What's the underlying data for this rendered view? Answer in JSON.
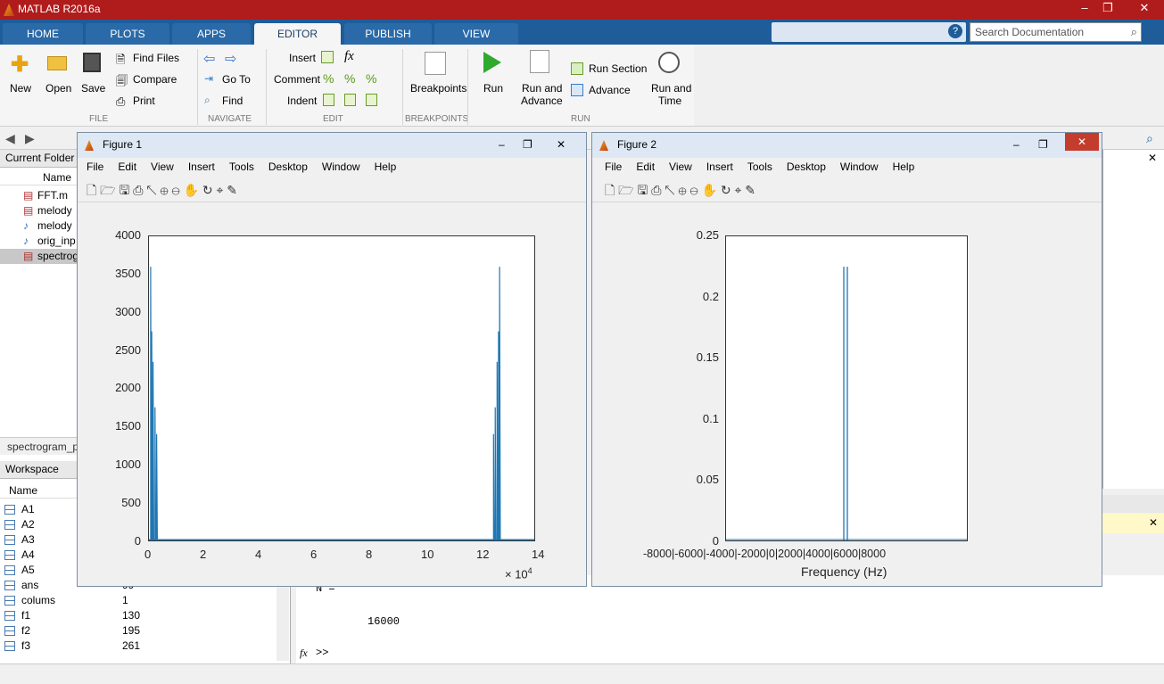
{
  "app": {
    "title": "MATLAB R2016a"
  },
  "ribbon": {
    "tabs": [
      "HOME",
      "PLOTS",
      "APPS",
      "EDITOR",
      "PUBLISH",
      "VIEW"
    ],
    "active_tab": "EDITOR",
    "search_placeholder": "Search Documentation",
    "file": {
      "new": "New",
      "open": "Open",
      "save": "Save",
      "find_files": "Find Files",
      "compare": "Compare",
      "print": "Print",
      "group": "FILE"
    },
    "navigate": {
      "go_to": "Go To",
      "find": "Find",
      "group": "NAVIGATE"
    },
    "edit": {
      "insert": "Insert",
      "comment": "Comment",
      "indent": "Indent",
      "fx": "fx",
      "group": "EDIT"
    },
    "breakpoints": {
      "label": "Breakpoints",
      "group": "BREAKPOINTS"
    },
    "run": {
      "run": "Run",
      "run_advance_1": "Run and",
      "run_advance_2": "Advance",
      "run_section": "Run Section",
      "advance": "Advance",
      "run_time_1": "Run and",
      "run_time_2": "Time",
      "group": "RUN"
    }
  },
  "current_folder": {
    "title": "Current Folder",
    "column": "Name",
    "files": [
      "FFT.m",
      "melody",
      "melody",
      "orig_inp",
      "spectrog"
    ],
    "selected_file": "spectrogram_p"
  },
  "workspace": {
    "title": "Workspace",
    "column": "Name",
    "vars": [
      {
        "name": "A1",
        "value": ""
      },
      {
        "name": "A2",
        "value": ""
      },
      {
        "name": "A3",
        "value": ""
      },
      {
        "name": "A4",
        "value": ""
      },
      {
        "name": "A5",
        "value": ""
      },
      {
        "name": "ans",
        "value": "99"
      },
      {
        "name": "colums",
        "value": "1"
      },
      {
        "name": "f1",
        "value": "130"
      },
      {
        "name": "f2",
        "value": "195"
      },
      {
        "name": "f3",
        "value": "261"
      }
    ]
  },
  "command_window": {
    "var_line": "N =",
    "value": "16000",
    "prompt": ">>",
    "fx": "fx"
  },
  "figure1": {
    "title": "Figure 1",
    "menu": [
      "File",
      "Edit",
      "View",
      "Insert",
      "Tools",
      "Desktop",
      "Window",
      "Help"
    ],
    "chart_data": {
      "type": "line",
      "xlim": [
        0,
        140000
      ],
      "ylim": [
        0,
        4000
      ],
      "x_ticks": [
        "0",
        "2",
        "4",
        "6",
        "8",
        "10",
        "12",
        "14"
      ],
      "y_ticks": [
        "0",
        "500",
        "1000",
        "1500",
        "2000",
        "2500",
        "3000",
        "3500",
        "4000"
      ],
      "x_exponent": "× 10",
      "x_exponent_power": "4",
      "series": [
        {
          "peaks": [
            {
              "x": 600,
              "y": 3600
            },
            {
              "x": 1000,
              "y": 2750
            },
            {
              "x": 1500,
              "y": 2350
            },
            {
              "x": 2200,
              "y": 1750
            },
            {
              "x": 2800,
              "y": 1400
            },
            {
              "x": 125200,
              "y": 1400
            },
            {
              "x": 125800,
              "y": 1750
            },
            {
              "x": 126500,
              "y": 2350
            },
            {
              "x": 127000,
              "y": 2750
            },
            {
              "x": 127400,
              "y": 3600
            }
          ]
        }
      ]
    }
  },
  "figure2": {
    "title": "Figure 2",
    "menu": [
      "File",
      "Edit",
      "View",
      "Insert",
      "Tools",
      "Desktop",
      "Window",
      "Help"
    ],
    "chart_data": {
      "type": "line",
      "xlabel": "Frequency (Hz)",
      "ylim": [
        0,
        0.25
      ],
      "y_ticks": [
        "0",
        "0.05",
        "0.1",
        "0.15",
        "0.2",
        "0.25"
      ],
      "x_tick_text": "-8000|-6000|-4000|-2000|0|2000|4000|6000|8000",
      "series": [
        {
          "peaks": [
            {
              "x": -261,
              "y": 0.225
            },
            {
              "x": 261,
              "y": 0.225
            }
          ]
        }
      ]
    }
  }
}
